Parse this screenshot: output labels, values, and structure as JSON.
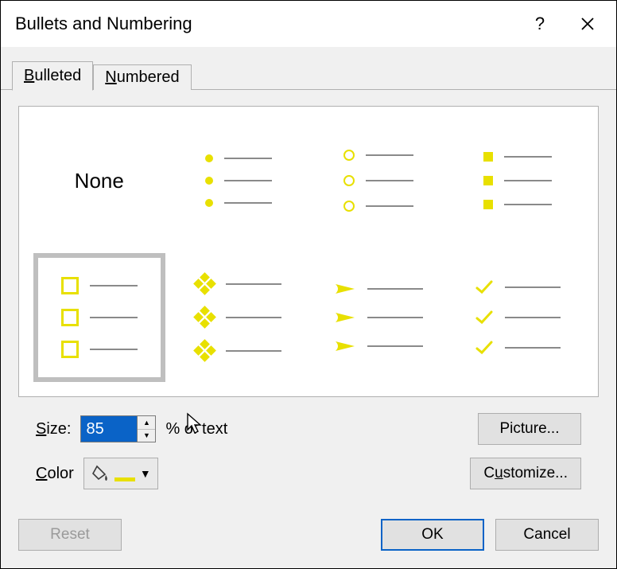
{
  "title": "Bullets and Numbering",
  "tabs": {
    "bulleted": "Bulleted",
    "numbered": "Numbered"
  },
  "gallery": {
    "none_label": "None"
  },
  "size": {
    "label": "Size:",
    "value": "85",
    "suffix": "% of text"
  },
  "color": {
    "label": "Color"
  },
  "buttons": {
    "picture": "Picture...",
    "customize": "Customize...",
    "reset": "Reset",
    "ok": "OK",
    "cancel": "Cancel"
  }
}
